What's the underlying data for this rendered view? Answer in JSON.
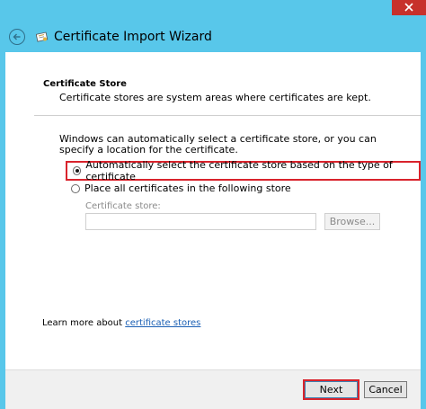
{
  "window": {
    "title": "Certificate Import Wizard"
  },
  "page": {
    "section_title": "Certificate Store",
    "section_desc": "Certificate stores are system areas where certificates are kept.",
    "intro": "Windows can automatically select a certificate store, or you can specify a location for the certificate.",
    "options": [
      {
        "label": "Automatically select the certificate store based on the type of certificate",
        "selected": true
      },
      {
        "label": "Place all certificates in the following store",
        "selected": false
      }
    ],
    "store_label": "Certificate store:",
    "store_value": "",
    "browse_label": "Browse...",
    "learn_more_prefix": "Learn more about",
    "learn_more_link": "certificate stores"
  },
  "footer": {
    "next_label": "Next",
    "cancel_label": "Cancel"
  },
  "colors": {
    "accent": "#58c7ea",
    "highlight": "#d9232c",
    "close_button": "#c7312b",
    "link": "#1a5fb4"
  },
  "icons": {
    "back": "back-arrow-icon",
    "wizard": "certificate-icon",
    "close": "close-icon"
  }
}
